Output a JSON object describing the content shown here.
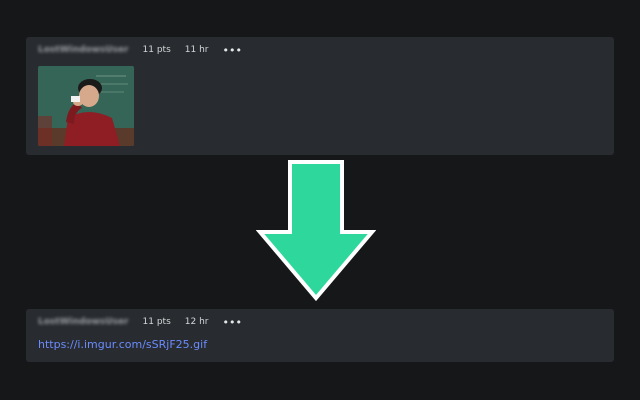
{
  "top_post": {
    "username": "LostWindowsUser",
    "points": "11 pts",
    "age": "11 hr",
    "more_icon": "•••"
  },
  "bottom_post": {
    "username": "LostWindowsUser",
    "points": "11 pts",
    "age": "12 hr",
    "more_icon": "•••",
    "link_text": "https://i.imgur.com/sSRjF25.gif"
  },
  "colors": {
    "background": "#161719",
    "card": "#282b2f",
    "link": "#6b8cff",
    "arrow_fill": "#2ed89c",
    "arrow_stroke": "#ffffff"
  },
  "icons": {
    "arrow": "down-arrow-icon",
    "more": "more-options-icon"
  }
}
